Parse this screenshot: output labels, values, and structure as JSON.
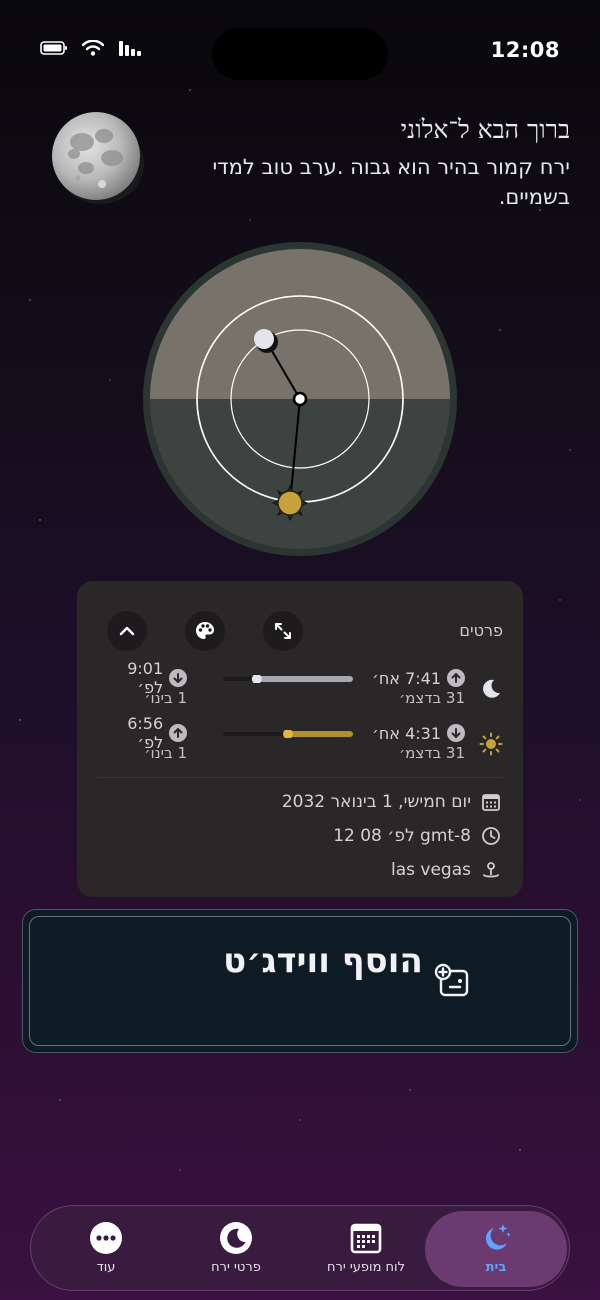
{
  "status_bar": {
    "time": "12:08"
  },
  "header": {
    "greeting": "ברוך הבא ל־אלוני",
    "subtitle": "ירח קמור בהיר הוא גבוה .ערב טוב למדי בשמיים."
  },
  "details": {
    "title": "פרטים",
    "moon": {
      "rise_time": "7:41 אח׳",
      "rise_date": "31 בדצמ׳",
      "set_time": "9:01 לפ׳",
      "set_date": "1 בינו׳",
      "progress": 0.74
    },
    "sun": {
      "rise_time": "4:31 אח׳",
      "rise_date": "31 בדצמ׳",
      "set_time": "6:56 לפ׳",
      "set_date": "1 בינו׳",
      "progress": 0.5
    },
    "date": "יום חמישי, 1 בינואר 2032",
    "time": "12 08 לפ׳ gmt-8",
    "location": "las vegas"
  },
  "add_widget": {
    "label": "הוסף ווידג׳ט"
  },
  "nav": [
    {
      "label": "בית",
      "icon": "moon-stars-icon",
      "active": true
    },
    {
      "label": "לוח מופעי ירח",
      "icon": "calendar-icon",
      "active": false
    },
    {
      "label": "פרטי ירח",
      "icon": "moon-icon",
      "active": false
    },
    {
      "label": "עוד",
      "icon": "more-icon",
      "active": false
    }
  ],
  "colors": {
    "sun": "#c6a13c",
    "moon": "#e3e4ee",
    "active_nav": "#5fa4ff",
    "card": "#2a2729"
  }
}
